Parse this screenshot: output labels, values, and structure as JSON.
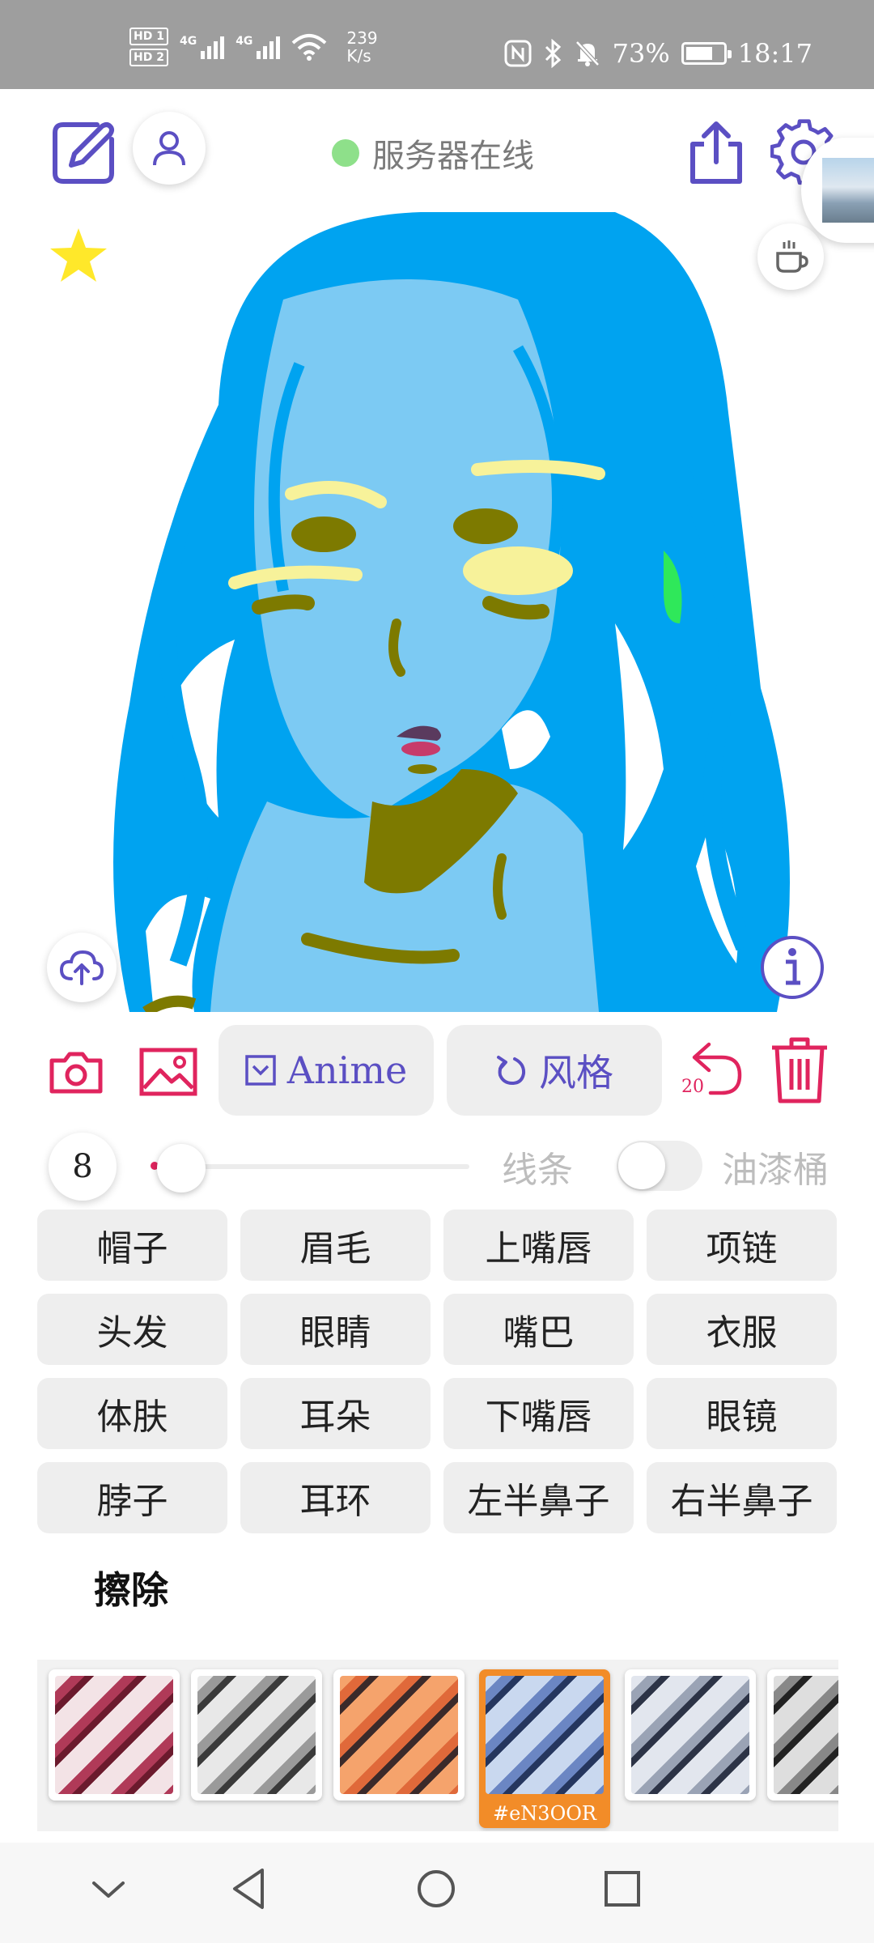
{
  "status_bar": {
    "hd1": "HD 1",
    "hd2": "HD 2",
    "sim1_label": "4G",
    "sim2_label": "4G",
    "net_speed_value": "239",
    "net_speed_unit": "K/s",
    "battery_percent": "73%",
    "battery_level": 0.73,
    "time": "18:17",
    "icons": [
      "nfc-icon",
      "bluetooth-icon",
      "mute-bell-icon",
      "battery-icon"
    ]
  },
  "toolbar": {
    "server_status": "服务器在线",
    "server_status_color": "#8ee08a",
    "accent_color": "#5b4fc3"
  },
  "actions": {
    "model_label": "Anime",
    "style_label": "风格",
    "undo_count": "20",
    "danger_color": "#e0245e"
  },
  "brush": {
    "size": "8",
    "line_label": "线条",
    "fill_label": "油漆桶",
    "bucket_enabled": false
  },
  "segments": [
    "帽子",
    "眉毛",
    "上嘴唇",
    "项链",
    "头发",
    "眼睛",
    "嘴巴",
    "衣服",
    "体肤",
    "耳朵",
    "下嘴唇",
    "眼镜",
    "脖子",
    "耳环",
    "左半鼻子",
    "右半鼻子"
  ],
  "erase_label": "擦除",
  "styles": [
    {
      "id": "style-1",
      "colors": [
        "#f3e3e6",
        "#b03a58",
        "#6b1a2d"
      ]
    },
    {
      "id": "style-2",
      "colors": [
        "#e8e8e8",
        "#9a9a9a",
        "#3a3a3a"
      ]
    },
    {
      "id": "style-3",
      "colors": [
        "#f5a36c",
        "#e0693a",
        "#3b2a2a"
      ]
    },
    {
      "id": "style-4",
      "colors": [
        "#c9d8ef",
        "#6b86c3",
        "#25365e"
      ],
      "selected": true,
      "tag": "#eN3OOR"
    },
    {
      "id": "style-5",
      "colors": [
        "#e2e6ee",
        "#9aa3b5",
        "#2c3346"
      ]
    },
    {
      "id": "style-6",
      "colors": [
        "#dedede",
        "#888888",
        "#222222"
      ]
    }
  ],
  "nav": [
    "back-chevron-icon",
    "back-triangle-icon",
    "home-circle-icon",
    "recents-square-icon"
  ]
}
